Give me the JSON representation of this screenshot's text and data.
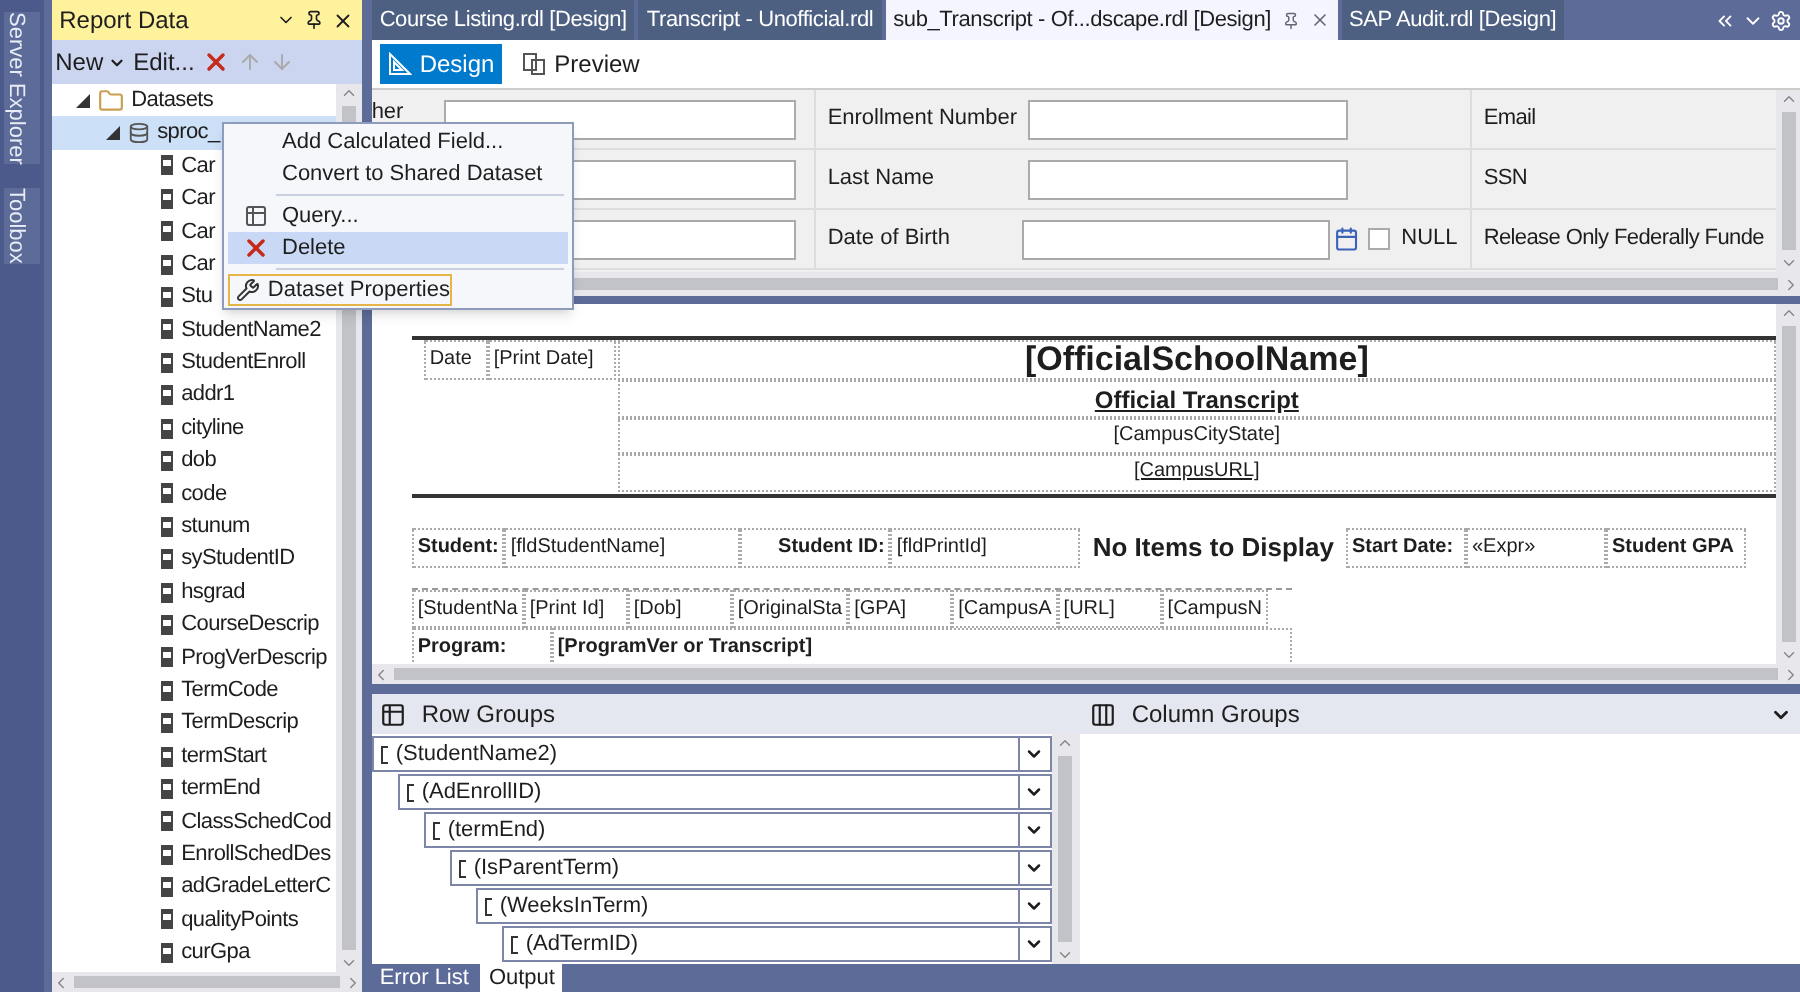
{
  "side_tabs": [
    {
      "label": "Server Explorer"
    },
    {
      "label": "Toolbox"
    }
  ],
  "report_data": {
    "title": "Report Data",
    "toolbar": {
      "new": "New",
      "edit": "Edit..."
    },
    "tree": [
      {
        "label": "Datasets",
        "kind": "folder",
        "expanded": true,
        "selected": false,
        "children": [
          {
            "label": "sproc_",
            "kind": "dataset",
            "expanded": true,
            "selected": true,
            "children": [
              {
                "label": "Car",
                "kind": "field"
              },
              {
                "label": "Car",
                "kind": "field"
              },
              {
                "label": "Car",
                "kind": "field"
              },
              {
                "label": "Car",
                "kind": "field"
              },
              {
                "label": "Stu",
                "kind": "field"
              },
              {
                "label": "StudentName2",
                "kind": "field"
              },
              {
                "label": "StudentEnroll",
                "kind": "field"
              },
              {
                "label": "addr1",
                "kind": "field"
              },
              {
                "label": "cityline",
                "kind": "field"
              },
              {
                "label": "dob",
                "kind": "field"
              },
              {
                "label": "code",
                "kind": "field"
              },
              {
                "label": "stunum",
                "kind": "field"
              },
              {
                "label": "syStudentID",
                "kind": "field"
              },
              {
                "label": "hsgrad",
                "kind": "field"
              },
              {
                "label": "CourseDescrip",
                "kind": "field"
              },
              {
                "label": "ProgVerDescrip",
                "kind": "field"
              },
              {
                "label": "TermCode",
                "kind": "field"
              },
              {
                "label": "TermDescrip",
                "kind": "field"
              },
              {
                "label": "termStart",
                "kind": "field"
              },
              {
                "label": "termEnd",
                "kind": "field"
              },
              {
                "label": "ClassSchedCod",
                "kind": "field"
              },
              {
                "label": "EnrollSchedDes",
                "kind": "field"
              },
              {
                "label": "adGradeLetterC",
                "kind": "field"
              },
              {
                "label": "qualityPoints",
                "kind": "field"
              },
              {
                "label": "curGpa",
                "kind": "field"
              }
            ]
          }
        ]
      }
    ]
  },
  "context_menu": {
    "items": [
      {
        "kind": "plain",
        "label": "Add Calculated Field...",
        "highlighted": false,
        "focused": false
      },
      {
        "kind": "plain",
        "label": "Convert to Shared Dataset",
        "highlighted": false,
        "focused": false
      },
      {
        "kind": "separator"
      },
      {
        "kind": "query",
        "label": "Query...",
        "highlighted": false,
        "focused": false
      },
      {
        "kind": "delete",
        "label": "Delete",
        "highlighted": true,
        "focused": false
      },
      {
        "kind": "separator"
      },
      {
        "kind": "properties",
        "label": "Dataset Properties",
        "highlighted": false,
        "focused": true
      }
    ]
  },
  "doc_tabs": [
    {
      "label": "Course Listing.rdl [Design]",
      "selected": false
    },
    {
      "label": "Transcript - Unofficial.rdl",
      "selected": false
    },
    {
      "label": "sub_Transcript - Of...dscape.rdl [Design]",
      "selected": true
    },
    {
      "label": "SAP Audit.rdl [Design]",
      "selected": false
    }
  ],
  "view_tabs": [
    {
      "label": "Design",
      "selected": true
    },
    {
      "label": "Preview",
      "selected": false
    }
  ],
  "parameters": [
    [
      {
        "kind": "text",
        "label": "her"
      },
      {
        "kind": "text",
        "label": "Enrollment Number"
      },
      {
        "kind": "label",
        "label": "Email"
      }
    ],
    [
      {
        "kind": "text"
      },
      {
        "kind": "text",
        "label": "Last Name"
      },
      {
        "kind": "label",
        "label": "SSN"
      }
    ],
    [
      {
        "kind": "text"
      },
      {
        "kind": "date",
        "label": "Date of Birth",
        "null_label": "NULL",
        "null_checked": false
      },
      {
        "kind": "label",
        "label": "Release Only Federally Funde"
      }
    ]
  ],
  "report": {
    "header": {
      "date_label": "Date",
      "date_value": "[Print Date]",
      "school": "[OfficialSchoolName]",
      "title": "Official Transcript",
      "city": "[CampusCityState]",
      "url": "[CampusURL]"
    },
    "student_row": [
      "Student:",
      "[fldStudentName]",
      "Student ID:",
      "[fldPrintId]"
    ],
    "overlay": "No Items to Display",
    "student_row_end": [
      "Start Date:",
      "«Expr»",
      "Student GPA"
    ],
    "detail_row": [
      "[StudentNa",
      "[Print Id]",
      "[Dob]",
      "[OriginalSta",
      "[GPA]",
      "[CampusA",
      "[URL]",
      "[CampusN"
    ],
    "program_row": [
      "Program:",
      "[ProgramVer or Transcript]"
    ]
  },
  "row_groups": {
    "title": "Row Groups",
    "groups": [
      {
        "label": "(StudentName2)",
        "children": [
          {
            "label": "(AdEnrollID)",
            "children": [
              {
                "label": "(termEnd)",
                "children": [
                  {
                    "label": "(IsParentTerm)",
                    "children": [
                      {
                        "label": "(WeeksInTerm)",
                        "children": [
                          {
                            "label": "(AdTermID)"
                          }
                        ]
                      }
                    ]
                  }
                ]
              }
            ]
          }
        ]
      }
    ]
  },
  "column_groups": {
    "title": "Column Groups"
  },
  "bottom_tabs": [
    {
      "label": "Error List",
      "selected": false
    },
    {
      "label": "Output",
      "selected": true
    }
  ]
}
